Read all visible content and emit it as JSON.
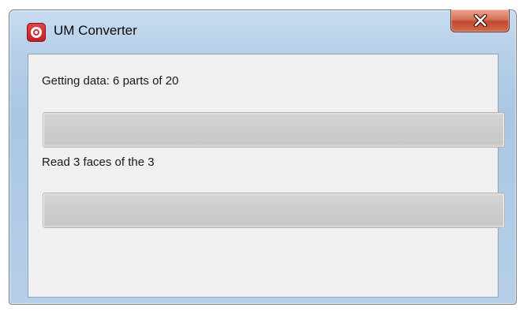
{
  "window": {
    "title": "UM Converter",
    "app_icon": "app-logo-icon",
    "close_icon": "close-icon"
  },
  "progress1": {
    "label": "Getting data: 6 parts of 20",
    "value_fraction": 0
  },
  "progress2": {
    "label": "Read 3 faces of the 3",
    "value_fraction": 0
  },
  "colors": {
    "close_button": "#c9553a",
    "progress_track": "#cdcdcd",
    "window_frame": "#aac6e4"
  }
}
